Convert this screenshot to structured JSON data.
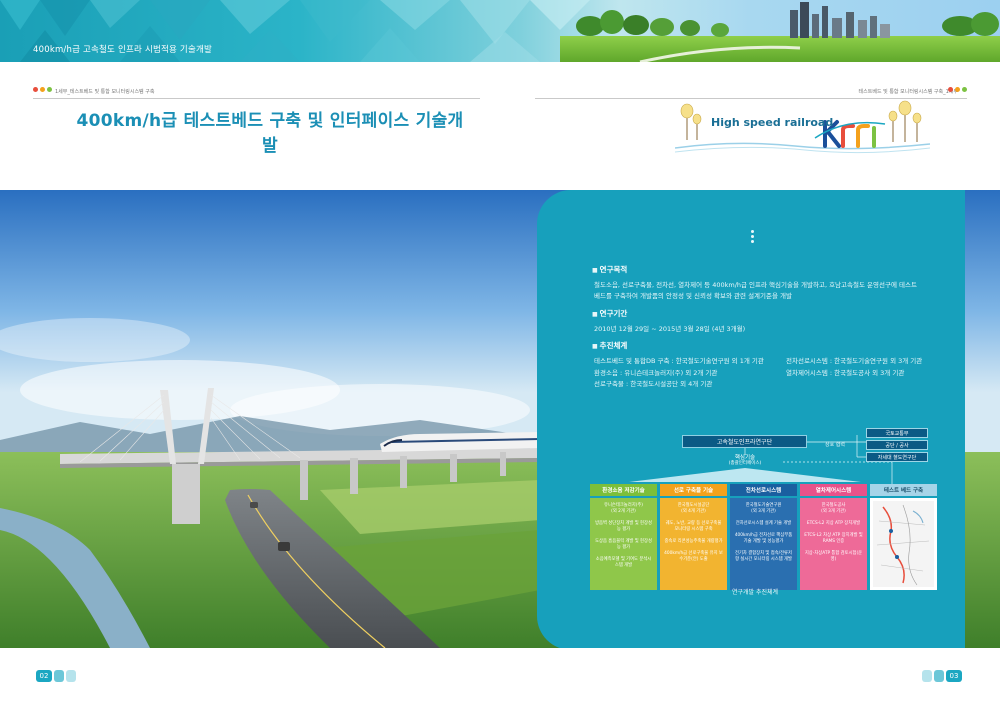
{
  "banner": {
    "title": "400km/h급 고속철도 인프라 시범적용 기술개발"
  },
  "header": {
    "breadcrumb_left": "1세부_테스트베드 및 통합 모니터링시스템 구축",
    "breadcrumb_right": "테스트베드 및 통합 모니터링시스템 구축_1세부",
    "title": "400km/h급 테스트베드 구축 및 인터페이스 기술개발",
    "brand_text": "High speed railroad",
    "dot_colors": [
      "#e84e3c",
      "#f4a11c",
      "#7cc242"
    ]
  },
  "panel": {
    "purpose": {
      "heading": "연구목적",
      "lines": [
        "철도소음, 선로구축물, 전차선, 열차제어 등 400km/h급 인프라 핵심기술을 개발하고, 호남고속철도 운영선구에 테스트",
        "베드를 구축하여 개발품의 안정성 및 신뢰성 확보와 관련 설계기준을 개발"
      ]
    },
    "period": {
      "heading": "연구기간",
      "text": "2010년 12월 29일 ~ 2015년 3월 28일 (4년 3개월)"
    },
    "system": {
      "heading": "추진체계",
      "items": [
        "테스트베드 및 통합DB 구축 : 한국철도기술연구원 외 1개 기관",
        "전차선로시스템 : 한국철도기술연구원 외 3개 기관",
        "환경소음 : 유니슨테크놀러지(주) 외 2개 기관",
        "열차제어시스템 : 한국철도공사 외 3개 기관",
        "선로구축물 : 한국철도시설공단 외 4개 기관",
        ""
      ]
    }
  },
  "org_chart": {
    "top": "고속철도인프라연구단",
    "cooperation": "상호 협력",
    "agencies": [
      "국토교통부",
      "공단 / 공사",
      "자세대 쳘도연구단"
    ],
    "core_title": "핵심기술",
    "core_sub": "(총괄인터페이스)",
    "columns": [
      {
        "header": "환경소음 저감기술",
        "header_color": "#7cbf3a",
        "body_color": "#8fc74a",
        "lines": [
          "유니슨테크놀러지(주)",
          "(외 2개 기관)",
          "방음벽 성단장치 개발 및 현장성능 평가",
          "도상음 흡음블럭 개발 및 현장성능 평가",
          "소음예측모델 및 기여도 분석시스템 개발"
        ]
      },
      {
        "header": "선로 구축물 기술",
        "header_color": "#f3a21c",
        "body_color": "#f2b430",
        "lines": [
          "한국철도시설공단",
          "(외 4개 기관)",
          "궤도, 노반, 교량 등 선로구축물 모니터링 시스템 구축",
          "중속로 리콘성능주축물 개량평가",
          "400km/h급 선로구축물 유지 보수기준(안) 도출"
        ]
      },
      {
        "header": "전차선로시스템",
        "header_color": "#1a5fa0",
        "body_color": "#2a6fb0",
        "lines": [
          "한국철도기술연구원",
          "(외 3개 기관)",
          "전차선로시스템 설계 기술 개발",
          "400km/h급 전차선로 핵심부품기술 개발 및 성능평가",
          "전기차 결합장치 및 접속/전류저항 실시간 모니터링 시스템 개발"
        ]
      },
      {
        "header": "열차제어시스템",
        "header_color": "#e8528a",
        "body_color": "#ee6a98",
        "lines": [
          "한국철도공사",
          "(외 3개 기관)",
          "ETCS-L2 지상 ATP 장치개발",
          "ETCS-L2 차상 ATP 장치개발 및 RAMS 인증",
          "지상-차상ATP 통합 검토시험(운영)"
        ]
      },
      {
        "header": "테스트 베드 구축",
        "header_color": "#a6d4e8",
        "body_color": "#ffffff",
        "lines": []
      }
    ],
    "caption": "연구개발 추진체계"
  },
  "footer": {
    "page_left": "02",
    "page_right": "03"
  }
}
